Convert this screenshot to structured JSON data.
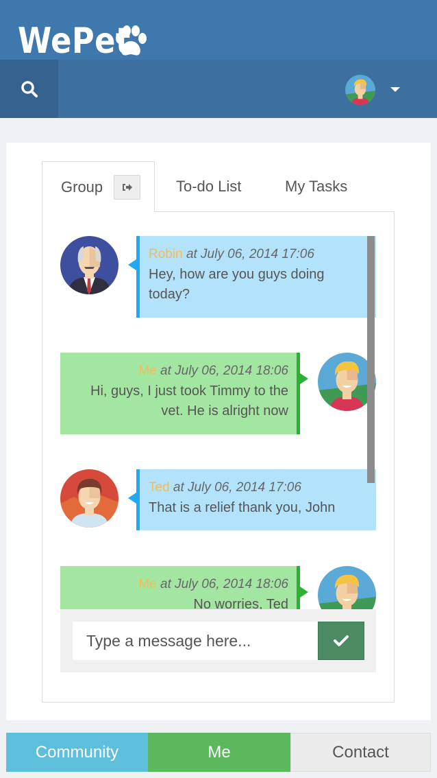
{
  "header": {
    "app_name": "WePet",
    "logo_icon": "paw-icon",
    "search_icon": "search-icon",
    "user_menu_icon": "caret-down-icon"
  },
  "tabs": [
    {
      "label": "Group",
      "active": true,
      "icon": "sign-out-icon"
    },
    {
      "label": "To-do List",
      "active": false
    },
    {
      "label": "My Tasks",
      "active": false
    }
  ],
  "messages": [
    {
      "sender": "Robin",
      "time": "at July 06, 2014 17:06",
      "lines": [
        "Hey, how are you guys doing",
        "today?"
      ],
      "direction": "incoming",
      "avatar": "robin-avatar"
    },
    {
      "sender": "Me",
      "time": "at July 06, 2014 18:06",
      "lines": [
        "Hi, guys, I just took Timmy to the",
        "vet. He is alright now"
      ],
      "direction": "outgoing",
      "avatar": "me-avatar"
    },
    {
      "sender": "Ted",
      "time": "at July 06, 2014 17:06",
      "lines": [
        "That is a relief thank you, John"
      ],
      "direction": "incoming",
      "avatar": "ted-avatar"
    },
    {
      "sender": "Me",
      "time": "at July 06, 2014 18:06",
      "lines": [
        "No worries, Ted"
      ],
      "direction": "outgoing",
      "avatar": "me-avatar"
    }
  ],
  "composer": {
    "placeholder": "Type a message here...",
    "value": "",
    "send_icon": "check-icon"
  },
  "bottom_nav": {
    "community": "Community",
    "me": "Me",
    "contact": "Contact"
  },
  "colors": {
    "header": "#3f78ad",
    "navbar": "#3d6f9f",
    "incoming_bubble": "#b3e3fb",
    "outgoing_bubble": "#a3e6a2",
    "sender_name": "#f6bb56",
    "community": "#5ebfdd",
    "me": "#5cb85c"
  }
}
